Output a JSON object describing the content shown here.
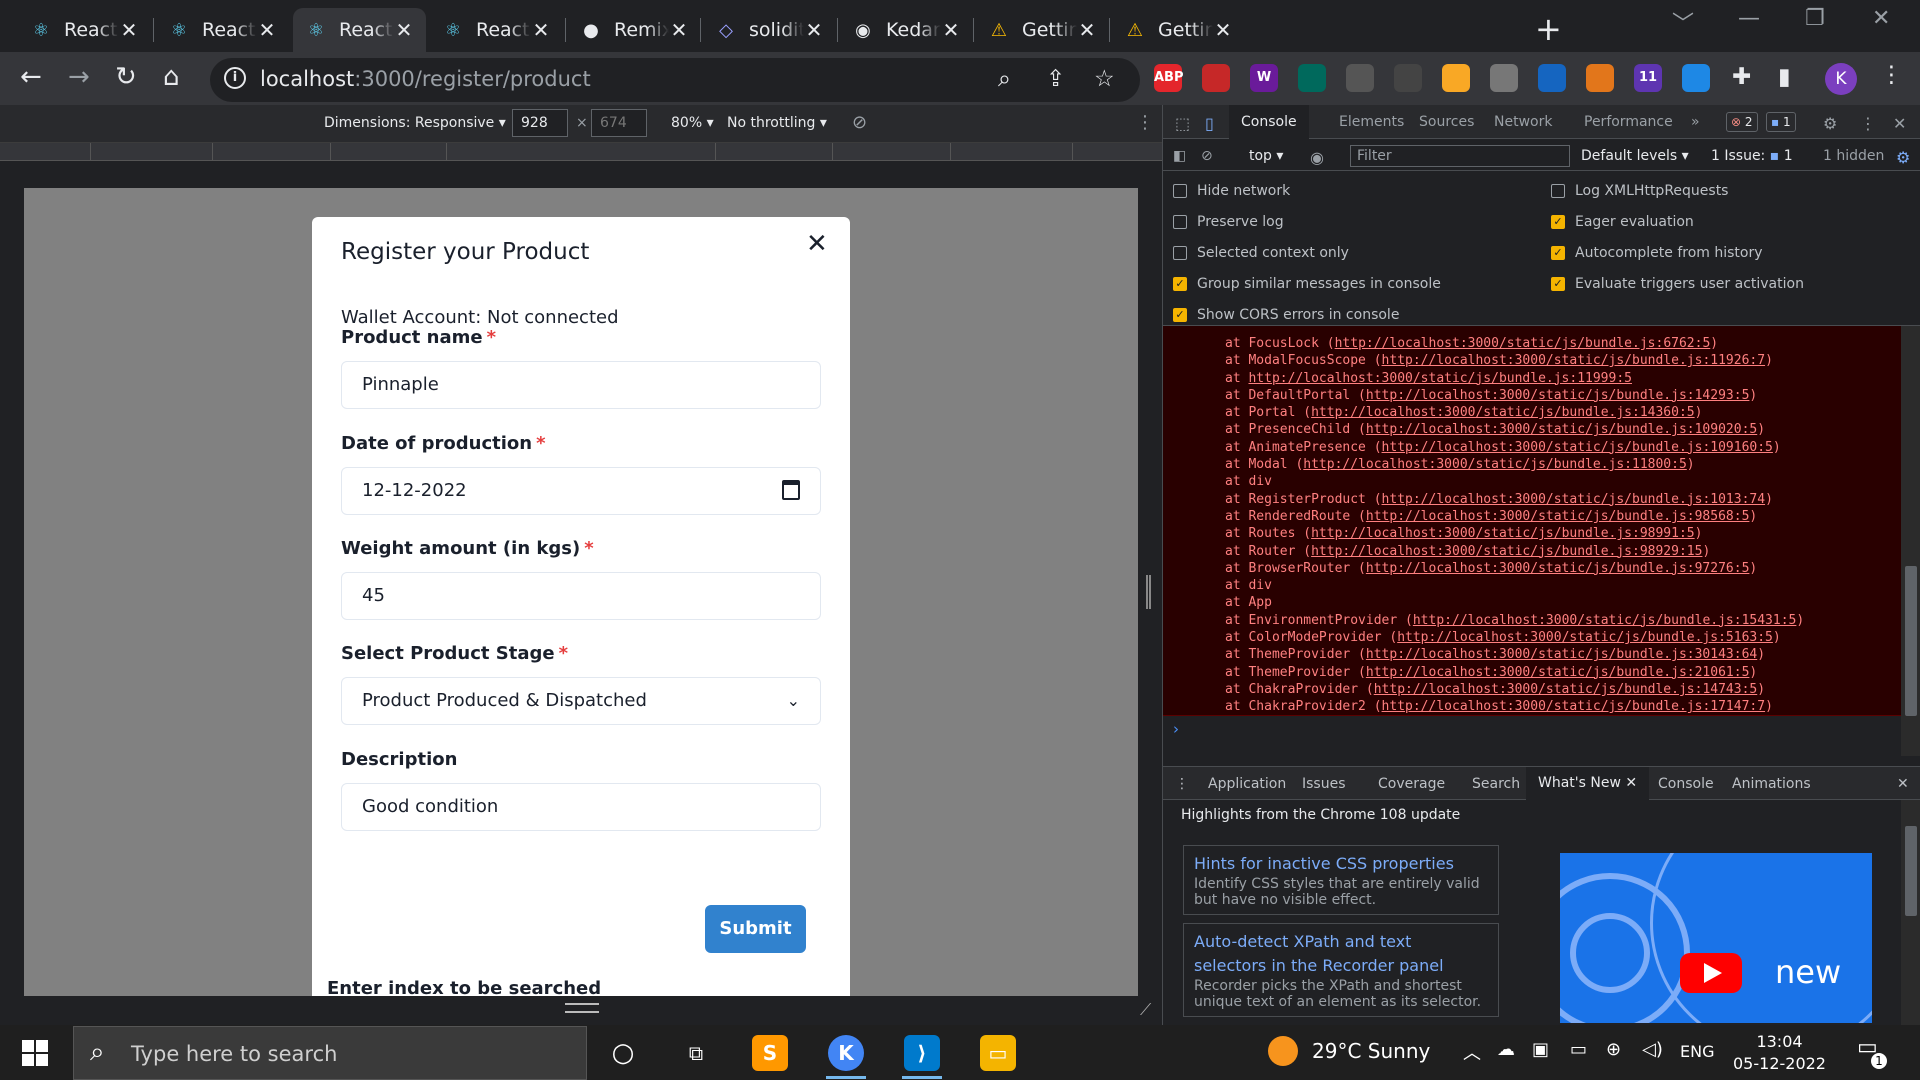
{
  "browser": {
    "tabs": [
      {
        "title": "React App",
        "icon": "react-icon",
        "active": false
      },
      {
        "title": "React App",
        "icon": "react-icon",
        "active": false
      },
      {
        "title": "React App",
        "icon": "react-icon",
        "active": true
      },
      {
        "title": "React App",
        "icon": "react-icon",
        "active": false
      },
      {
        "title": "Remix - Ethereum IDE",
        "icon": "remix-icon",
        "active": false
      },
      {
        "title": "solidity",
        "icon": "solidity-icon",
        "active": false
      },
      {
        "title": "KedarKK",
        "icon": "github-icon",
        "active": false
      },
      {
        "title": "Getting started",
        "icon": "warning-icon",
        "active": false
      },
      {
        "title": "Getting started",
        "icon": "warning-icon",
        "active": false
      }
    ],
    "tab_close": "✕",
    "new_tab": "+",
    "url_host": "localhost",
    "url_path": ":3000/register/product",
    "extensions": [
      {
        "name": "abp-icon",
        "label": "ABP",
        "color": "#e4262c"
      },
      {
        "name": "pdf-icon",
        "label": "",
        "color": "#c62828"
      },
      {
        "name": "w-icon",
        "label": "W",
        "color": "#6a1b9a"
      },
      {
        "name": "chart-ext-icon",
        "label": "",
        "color": "#00695c"
      },
      {
        "name": "cylinder-icon",
        "label": "",
        "color": "#555555"
      },
      {
        "name": "target-icon",
        "label": "",
        "color": "#444444"
      },
      {
        "name": "stack-icon",
        "label": "",
        "color": "#f9a825"
      },
      {
        "name": "glasses-icon",
        "label": "",
        "color": "#777777"
      },
      {
        "name": "circle-ext-icon",
        "label": "",
        "color": "#1565c0"
      },
      {
        "name": "metamask-icon",
        "label": "",
        "color": "#e2761b"
      },
      {
        "name": "counter-ext-icon",
        "label": "11",
        "color": "#5e35b1"
      },
      {
        "name": "screen-ext-icon",
        "label": "",
        "color": "#1e88e5"
      }
    ],
    "profile_initial": "K"
  },
  "device_toolbar": {
    "dimensions_label": "Dimensions: Responsive",
    "width": "928",
    "height": "674",
    "zoom": "80%",
    "throttling": "No throttling"
  },
  "modal": {
    "title": "Register your Product",
    "wallet": "Wallet Account: Not connected",
    "fields": [
      {
        "label": "Product name",
        "required": true,
        "value": "Pinnaple",
        "type": "text"
      },
      {
        "label": "Date of production",
        "required": true,
        "value": "12-12-2022",
        "type": "date"
      },
      {
        "label": "Weight amount (in kgs)",
        "required": true,
        "value": "45",
        "type": "number"
      },
      {
        "label": "Select Product Stage",
        "required": true,
        "value": "Product Produced & Dispatched",
        "type": "select"
      },
      {
        "label": "Description",
        "required": false,
        "value": "Good condition",
        "type": "text"
      }
    ],
    "required_mark": "*",
    "submit_label": "Submit",
    "close": "✕",
    "below_text": "Enter index to be searched"
  },
  "devtools": {
    "tabs": [
      "Console",
      "Elements",
      "Sources",
      "Network",
      "Performance"
    ],
    "more_tabs": "»",
    "error_count": "2",
    "message_count": "1",
    "context": "top",
    "filter_placeholder": "Filter",
    "levels": "Default levels",
    "issue_label": "1 Issue:",
    "issue_count": "1",
    "hidden": "1 hidden",
    "options_left": [
      {
        "label": "Hide network",
        "checked": false
      },
      {
        "label": "Preserve log",
        "checked": false
      },
      {
        "label": "Selected context only",
        "checked": false
      },
      {
        "label": "Group similar messages in console",
        "checked": true
      },
      {
        "label": "Show CORS errors in console",
        "checked": true
      }
    ],
    "options_right": [
      {
        "label": "Log XMLHttpRequests",
        "checked": false
      },
      {
        "label": "Eager evaluation",
        "checked": true
      },
      {
        "label": "Autocomplete from history",
        "checked": true
      },
      {
        "label": "Evaluate triggers user activation",
        "checked": true
      }
    ],
    "stack": [
      {
        "fn": "FocusLock",
        "link": "http://localhost:3000/static/js/bundle.js:6762:5"
      },
      {
        "fn": "ModalFocusScope",
        "link": "http://localhost:3000/static/js/bundle.js:11926:7"
      },
      {
        "fn": "",
        "link": "http://localhost:3000/static/js/bundle.js:11999:5"
      },
      {
        "fn": "DefaultPortal",
        "link": "http://localhost:3000/static/js/bundle.js:14293:5"
      },
      {
        "fn": "Portal",
        "link": "http://localhost:3000/static/js/bundle.js:14360:5"
      },
      {
        "fn": "PresenceChild",
        "link": "http://localhost:3000/static/js/bundle.js:109020:5"
      },
      {
        "fn": "AnimatePresence",
        "link": "http://localhost:3000/static/js/bundle.js:109160:5"
      },
      {
        "fn": "Modal",
        "link": "http://localhost:3000/static/js/bundle.js:11800:5"
      },
      {
        "fn": "div",
        "link": ""
      },
      {
        "fn": "RegisterProduct",
        "link": "http://localhost:3000/static/js/bundle.js:1013:74"
      },
      {
        "fn": "RenderedRoute",
        "link": "http://localhost:3000/static/js/bundle.js:98568:5"
      },
      {
        "fn": "Routes",
        "link": "http://localhost:3000/static/js/bundle.js:98991:5"
      },
      {
        "fn": "Router",
        "link": "http://localhost:3000/static/js/bundle.js:98929:15"
      },
      {
        "fn": "BrowserRouter",
        "link": "http://localhost:3000/static/js/bundle.js:97276:5"
      },
      {
        "fn": "div",
        "link": ""
      },
      {
        "fn": "App",
        "link": ""
      },
      {
        "fn": "EnvironmentProvider",
        "link": "http://localhost:3000/static/js/bundle.js:15431:5"
      },
      {
        "fn": "ColorModeProvider",
        "link": "http://localhost:3000/static/js/bundle.js:5163:5"
      },
      {
        "fn": "ThemeProvider",
        "link": "http://localhost:3000/static/js/bundle.js:30143:64"
      },
      {
        "fn": "ThemeProvider",
        "link": "http://localhost:3000/static/js/bundle.js:21061:5"
      },
      {
        "fn": "ChakraProvider",
        "link": "http://localhost:3000/static/js/bundle.js:14743:5"
      },
      {
        "fn": "ChakraProvider2",
        "link": "http://localhost:3000/static/js/bundle.js:17147:7"
      }
    ],
    "prompt": "›",
    "drawer_tabs": [
      "Application",
      "Issues",
      "Coverage",
      "Search",
      "What's New",
      "Console",
      "Animations"
    ],
    "drawer_active": "What's New",
    "whatsnew_title": "Highlights from the Chrome 108 update",
    "features": [
      {
        "title": "Hints for inactive CSS properties",
        "desc": "Identify CSS styles that are entirely valid but have no visible effect."
      },
      {
        "title": "Auto-detect XPath and text selectors in the Recorder panel",
        "desc": "Recorder picks the XPath and shortest unique text of an element as its selector."
      }
    ],
    "video_text": "new"
  },
  "taskbar": {
    "search_placeholder": "Type here to search",
    "weather": "29°C  Sunny",
    "lang": "ENG",
    "time": "13:04",
    "date": "05-12-2022",
    "notif_count": "1"
  }
}
